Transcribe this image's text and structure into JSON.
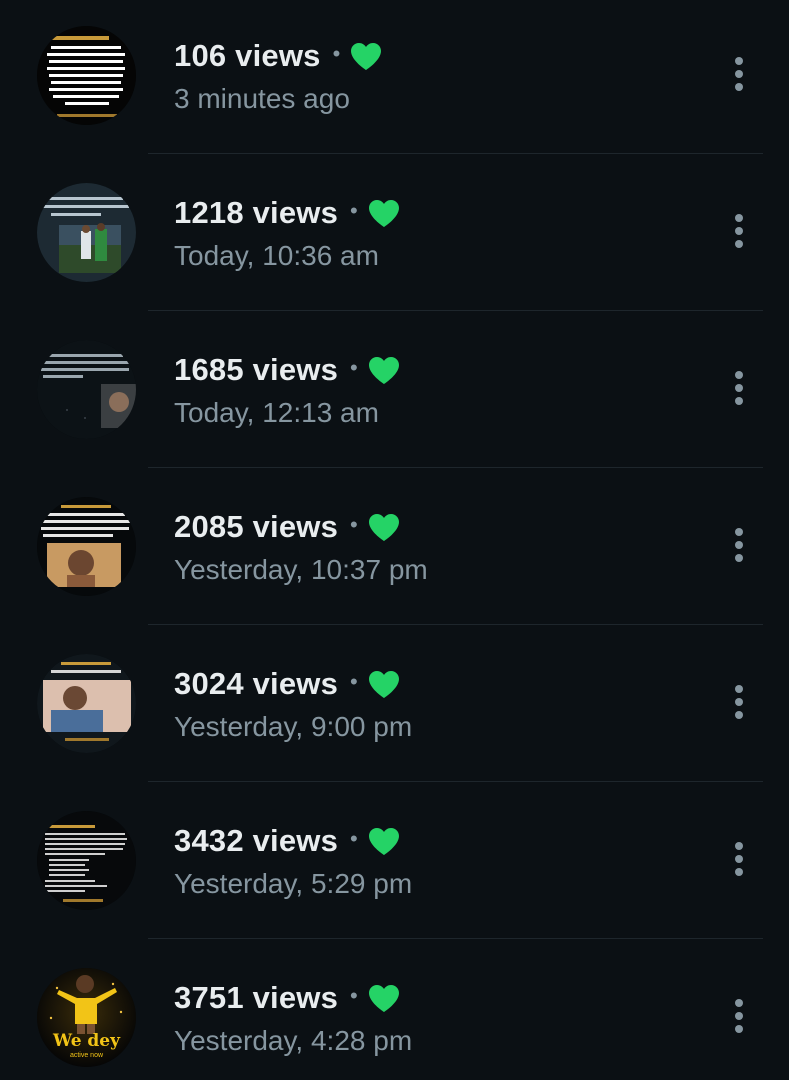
{
  "accent_color": "#25d366",
  "items": [
    {
      "views": "106 views",
      "time": "3 minutes ago",
      "thumb": "text-status"
    },
    {
      "views": "1218 views",
      "time": "Today, 10:36 am",
      "thumb": "football-photo"
    },
    {
      "views": "1685 views",
      "time": "Today, 12:13 am",
      "thumb": "dark-photo"
    },
    {
      "views": "2085 views",
      "time": "Yesterday, 10:37 pm",
      "thumb": "girl-photo"
    },
    {
      "views": "3024 views",
      "time": "Yesterday, 9:00 pm",
      "thumb": "boy-photo"
    },
    {
      "views": "3432 views",
      "time": "Yesterday, 5:29 pm",
      "thumb": "text-list"
    },
    {
      "views": "3751 views",
      "time": "Yesterday, 4:28 pm",
      "thumb": "kid-we-dey",
      "thumb_caption": "We dey",
      "thumb_subcaption": "active now"
    }
  ],
  "separator_glyph": "•",
  "heart_icon": "heart-icon",
  "menu_icon": "more-vert-icon"
}
